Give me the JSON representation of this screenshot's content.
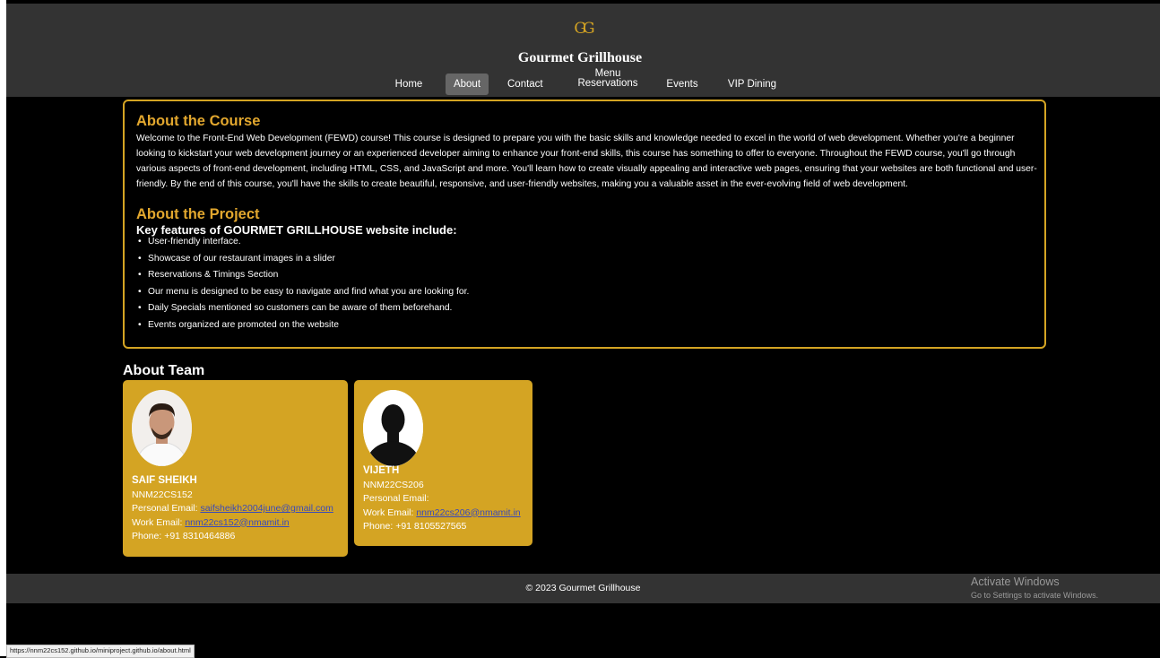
{
  "header": {
    "logo_text": "GG",
    "brand": "Gourmet Grillhouse",
    "nav": [
      {
        "label": "Home"
      },
      {
        "label": "About"
      },
      {
        "label": "Contact"
      },
      {
        "label": "Menu Reservations"
      },
      {
        "label": "Events"
      },
      {
        "label": "VIP Dining"
      }
    ]
  },
  "course": {
    "heading": "About the Course",
    "text": "Welcome to the Front-End Web Development (FEWD) course! This course is designed to prepare you with the basic skills and knowledge needed to excel in the world of web development. Whether you're a beginner looking to kickstart your web development journey or an experienced developer aiming to enhance your front-end skills, this course has something to offer to everyone. Throughout the FEWD course, you'll go through various aspects of front-end development, including HTML, CSS, and JavaScript and more. You'll learn how to create visually appealing and interactive web pages, ensuring that your websites are both functional and user-friendly. By the end of this course, you'll have the skills to create beautiful, responsive, and user-friendly websites, making you a valuable asset in the ever-evolving field of web development."
  },
  "project": {
    "heading": "About the Project",
    "features_title": "Key features of GOURMET GRILLHOUSE website include:",
    "features": [
      "User-friendly interface.",
      "Showcase of our restaurant images in a slider",
      "Reservations & Timings Section",
      "Our menu is designed to be easy to navigate and find what you are looking for.",
      "Daily Specials mentioned so customers can be aware of them beforehand.",
      "Events organized are promoted on the website"
    ]
  },
  "team": {
    "heading": "About Team",
    "members": [
      {
        "name": "SAIF SHEIKH",
        "id": "NNM22CS152",
        "personal_label": "Personal Email:",
        "personal_email": "saifsheikh2004june@gmail.com",
        "work_label": "Work Email:",
        "work_email": "nnm22cs152@nmamit.in",
        "phone": "Phone: +91 8310464886"
      },
      {
        "name": "VIJETH",
        "id": "NNM22CS206",
        "personal_label": "Personal Email:",
        "personal_email": "",
        "work_label": "Work Email:",
        "work_email": "nnm22cs206@nmamit.in",
        "phone": "Phone: +91 8105527565"
      }
    ]
  },
  "footer": {
    "copyright": "© 2023 Gourmet Grillhouse"
  },
  "watermark": {
    "title": "Activate Windows",
    "subtitle": "Go to Settings to activate Windows."
  },
  "statusbar": {
    "url": "https://nnm22cs152.github.io/miniproject.github.io/about.html"
  },
  "colors": {
    "accent": "#d4a423",
    "header_bg": "#333333",
    "heading_gold": "#e2a72e"
  }
}
